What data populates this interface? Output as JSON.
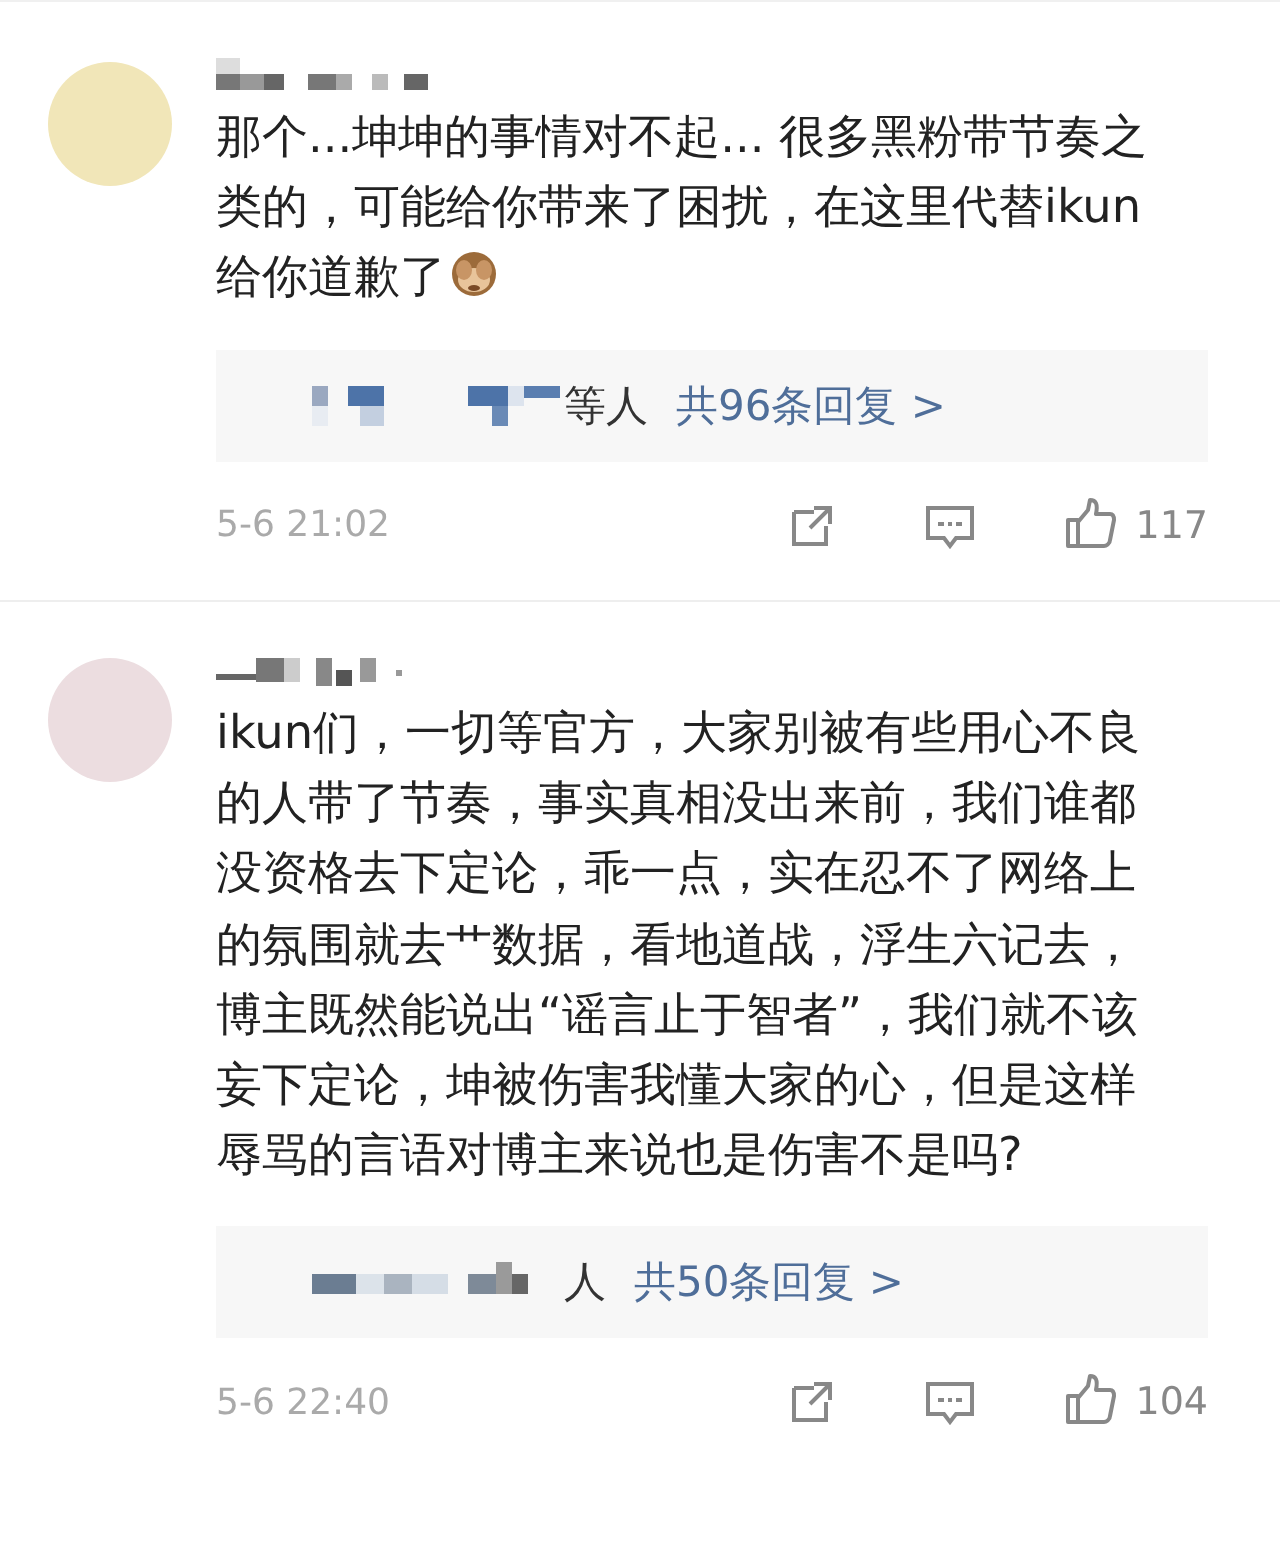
{
  "comments": [
    {
      "text": "那个...坤坤的事情对不起... 很多黑粉带节奏之类的，可能给你带来了困扰，在这里代替ikun给你道歉了",
      "emoji": true,
      "replies": {
        "names_suffix": "等人",
        "summary": "共96条回复 >"
      },
      "time": "5-6 21:02",
      "likes": "117"
    },
    {
      "text": "ikun们，一切等官方，大家别被有些用心不良的人带了节奏，事实真相没出来前，我们谁都没资格去下定论，乖一点，实在忍不了网络上的氛围就去艹数据，看地道战，浮生六记去，博主既然能说出“谣言止于智者”，我们就不该妄下定论，坤被伤害我懂大家的心，但是这样辱骂的言语对博主来说也是伤害不是吗?",
      "emoji": false,
      "replies": {
        "names_suffix": "人",
        "summary": "共50条回复 >"
      },
      "time": "5-6 22:40",
      "likes": "104"
    }
  ]
}
